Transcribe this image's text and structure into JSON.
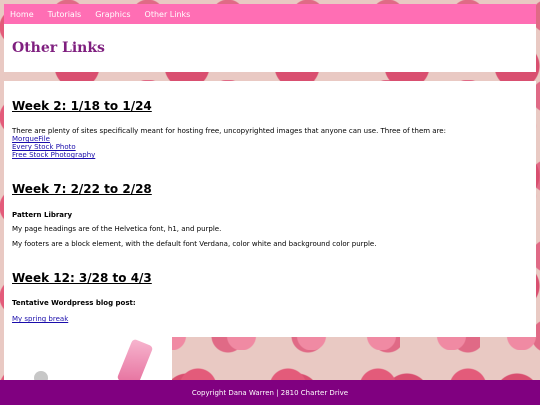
{
  "nav": {
    "items": [
      "Home",
      "Tutorials",
      "Graphics",
      "Other Links"
    ]
  },
  "header": {
    "title": "Other Links"
  },
  "sections": [
    {
      "heading": "Week 2: 1/18 to 1/24",
      "intro": "There are plenty of sites specifically meant for hosting free, uncopyrighted images that anyone can use. Three of them are:",
      "links": [
        "MorgueFile",
        "Every Stock Photo",
        "Free Stock Photography"
      ]
    },
    {
      "heading": "Week 7: 2/22 to 2/28",
      "subheading": "Pattern Library",
      "lines": [
        "My page headings are of the Helvetica font, h1, and purple.",
        "My footers are a block element, with the default font Verdana, color white and background color purple."
      ]
    },
    {
      "heading": "Week 12: 3/28 to 4/3",
      "subheading": "Tentative Wordpress blog post:",
      "link": "My spring break"
    }
  ],
  "footer": {
    "text": "Copyright Dana Warren | 2810 Charter Drive"
  },
  "colors": {
    "nav_bg": "#ff6eb4",
    "title": "#7f1f7f",
    "footer_bg": "#800080",
    "link": "#1a0dab"
  }
}
